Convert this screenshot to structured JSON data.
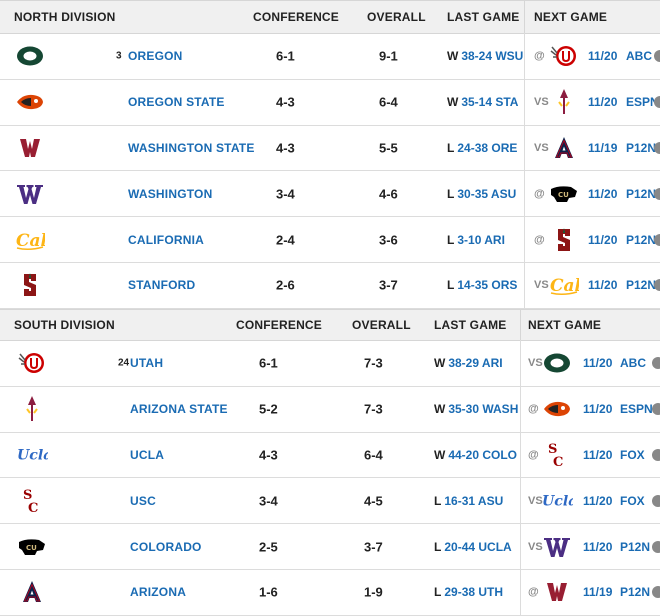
{
  "north": {
    "title": "NORTH DIVISION",
    "col_conference": "CONFERENCE",
    "col_overall": "OVERALL",
    "col_last": "LAST GAME",
    "col_next": "NEXT GAME",
    "teams": [
      {
        "rank": "3",
        "name": "OREGON",
        "logo": "oregon-logo",
        "conf": "6-1",
        "overall": "9-1",
        "last_wl": "W",
        "last_score": "38-24 WSU",
        "next_prefix": "@",
        "next_logo": "utah-logo",
        "next_date": "11/20",
        "next_network": "ABC"
      },
      {
        "rank": "",
        "name": "OREGON STATE",
        "logo": "oregon-state-logo",
        "conf": "4-3",
        "overall": "6-4",
        "last_wl": "W",
        "last_score": "35-14 STA",
        "next_prefix": "VS",
        "next_logo": "arizona-state-logo",
        "next_date": "11/20",
        "next_network": "ESPN"
      },
      {
        "rank": "",
        "name": "WASHINGTON STATE",
        "logo": "washington-state-logo",
        "conf": "4-3",
        "overall": "5-5",
        "last_wl": "L",
        "last_score": "24-38 ORE",
        "next_prefix": "VS",
        "next_logo": "arizona-logo",
        "next_date": "11/19",
        "next_network": "P12N"
      },
      {
        "rank": "",
        "name": "WASHINGTON",
        "logo": "washington-logo",
        "conf": "3-4",
        "overall": "4-6",
        "last_wl": "L",
        "last_score": "30-35 ASU",
        "next_prefix": "@",
        "next_logo": "colorado-logo",
        "next_date": "11/20",
        "next_network": "P12N"
      },
      {
        "rank": "",
        "name": "CALIFORNIA",
        "logo": "california-logo",
        "conf": "2-4",
        "overall": "3-6",
        "last_wl": "L",
        "last_score": "3-10 ARI",
        "next_prefix": "@",
        "next_logo": "stanford-logo",
        "next_date": "11/20",
        "next_network": "P12N"
      },
      {
        "rank": "",
        "name": "STANFORD",
        "logo": "stanford-logo",
        "conf": "2-6",
        "overall": "3-7",
        "last_wl": "L",
        "last_score": "14-35 ORS",
        "next_prefix": "VS",
        "next_logo": "california-logo",
        "next_date": "11/20",
        "next_network": "P12N"
      }
    ]
  },
  "south": {
    "title": "SOUTH DIVISION",
    "col_conference": "CONFERENCE",
    "col_overall": "OVERALL",
    "col_last": "LAST GAME",
    "col_next": "NEXT GAME",
    "teams": [
      {
        "rank": "24",
        "name": "UTAH",
        "logo": "utah-logo",
        "conf": "6-1",
        "overall": "7-3",
        "last_wl": "W",
        "last_score": "38-29 ARI",
        "next_prefix": "VS",
        "next_logo": "oregon-logo",
        "next_date": "11/20",
        "next_network": "ABC"
      },
      {
        "rank": "",
        "name": "ARIZONA STATE",
        "logo": "arizona-state-logo",
        "conf": "5-2",
        "overall": "7-3",
        "last_wl": "W",
        "last_score": "35-30 WASH",
        "next_prefix": "@",
        "next_logo": "oregon-state-logo",
        "next_date": "11/20",
        "next_network": "ESPN"
      },
      {
        "rank": "",
        "name": "UCLA",
        "logo": "ucla-logo",
        "conf": "4-3",
        "overall": "6-4",
        "last_wl": "W",
        "last_score": "44-20 COLO",
        "next_prefix": "@",
        "next_logo": "usc-logo",
        "next_date": "11/20",
        "next_network": "FOX"
      },
      {
        "rank": "",
        "name": "USC",
        "logo": "usc-logo",
        "conf": "3-4",
        "overall": "4-5",
        "last_wl": "L",
        "last_score": "16-31 ASU",
        "next_prefix": "VS",
        "next_logo": "ucla-logo",
        "next_date": "11/20",
        "next_network": "FOX"
      },
      {
        "rank": "",
        "name": "COLORADO",
        "logo": "colorado-logo",
        "conf": "2-5",
        "overall": "3-7",
        "last_wl": "L",
        "last_score": "20-44 UCLA",
        "next_prefix": "VS",
        "next_logo": "washington-logo",
        "next_date": "11/20",
        "next_network": "P12N"
      },
      {
        "rank": "",
        "name": "ARIZONA",
        "logo": "arizona-logo",
        "conf": "1-6",
        "overall": "1-9",
        "last_wl": "L",
        "last_score": "29-38 UTH",
        "next_prefix": "@",
        "next_logo": "washington-state-logo",
        "next_date": "11/19",
        "next_network": "P12N"
      }
    ]
  },
  "colors": {
    "link": "#1a6bb3",
    "header_bg": "#f0f0f0",
    "border": "#dcdcdc",
    "muted": "#888888"
  }
}
